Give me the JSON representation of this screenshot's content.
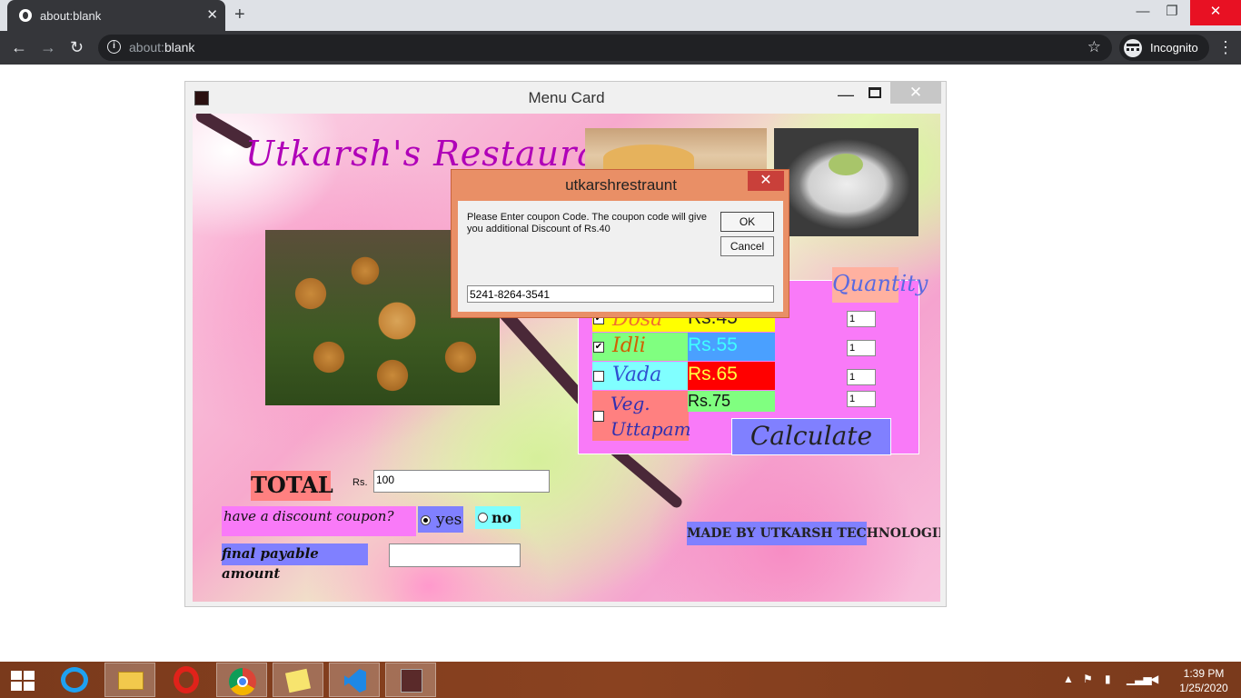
{
  "browser": {
    "tab_title": "about:blank",
    "tab_close": "✕",
    "new_tab": "+",
    "url_dim": "about:",
    "url_main": "blank",
    "incognito_label": "Incognito"
  },
  "app": {
    "window_title": "Menu Card",
    "heading": "Utkarsh's Restaurant",
    "quantity_label": "Quantity",
    "items": [
      {
        "name": "Dosa",
        "price": "Rs.45",
        "checked": true,
        "qty": "1"
      },
      {
        "name": "Idli",
        "price": "Rs.55",
        "checked": true,
        "qty": "1"
      },
      {
        "name": "Vada",
        "price": "Rs.65",
        "checked": false,
        "qty": "1"
      },
      {
        "name": "Veg. Uttapam",
        "price": "Rs.75",
        "checked": false,
        "qty": "1"
      }
    ],
    "calculate_label": "Calculate",
    "total_label": "TOTAL",
    "rs_label": "Rs.",
    "total_value": "100",
    "discount_question": "have a discount coupon?",
    "yes_label": "yes",
    "no_label": "no",
    "discount_selected": "yes",
    "final_label": "final payable amount",
    "final_value": "",
    "made_by": "MADE BY UTKARSH TECHNOLOGIES"
  },
  "dialog": {
    "title": "utkarshrestraunt",
    "close": "✕",
    "message": "Please Enter coupon Code. The coupon code will give you additional Discount of Rs.40",
    "ok_label": "OK",
    "cancel_label": "Cancel",
    "input_value": "5241-8264-3541"
  },
  "taskbar": {
    "time": "1:39 PM",
    "date": "1/25/2020"
  },
  "colors": {
    "heading": "#b000b8",
    "panel": "#f97af8",
    "dialog_frame": "#e98f66",
    "taskbar": "#7a3a1c"
  }
}
